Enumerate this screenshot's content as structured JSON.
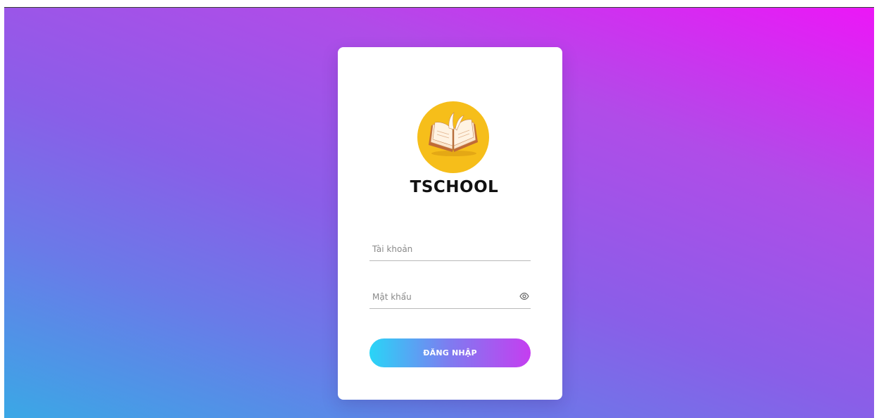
{
  "app": {
    "brand_name": "TSCHOOL",
    "logo_icon": "open-book-icon",
    "logo_color": "#f6be1a"
  },
  "login_form": {
    "username": {
      "placeholder": "Tài khoản",
      "value": ""
    },
    "password": {
      "placeholder": "Mật khẩu",
      "value": "",
      "toggle_icon": "eye-icon"
    },
    "submit_label": "ĐĂNG NHẬP"
  },
  "theme": {
    "background_gradient": [
      "#ec17f7",
      "#8a5ee8",
      "#3aa8e6"
    ],
    "button_gradient": [
      "#29d5f7",
      "#c53ef0"
    ]
  }
}
